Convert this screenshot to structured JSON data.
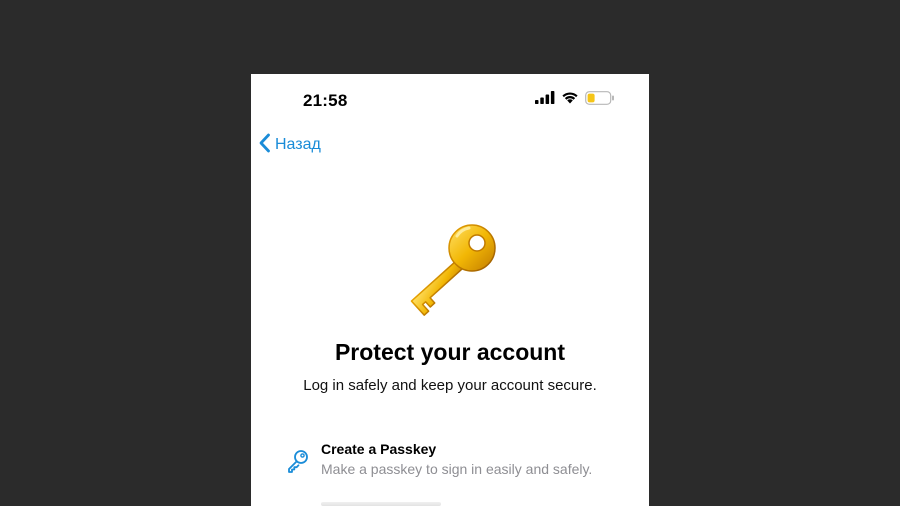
{
  "status_bar": {
    "time": "21:58"
  },
  "nav": {
    "back_label": "Назад"
  },
  "content": {
    "title": "Protect your account",
    "subtitle": "Log in safely and keep your account secure."
  },
  "options": [
    {
      "title": "Create a Passkey",
      "description": "Make a passkey to sign in easily and safely.",
      "icon": "key-outline-icon"
    }
  ],
  "colors": {
    "accent": "#1A8CD8",
    "background": "#2B2B2B",
    "screen": "#FFFFFF",
    "secondary_text": "#8E8E93",
    "battery_fill": "#F5C518",
    "key_gold": "#F2B705"
  }
}
